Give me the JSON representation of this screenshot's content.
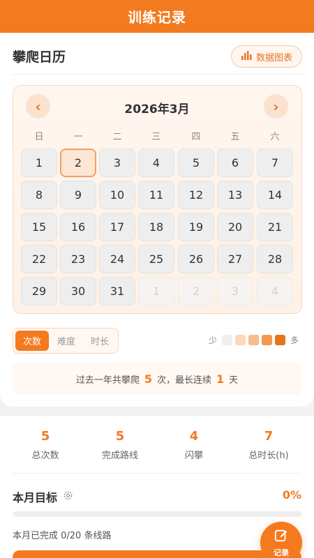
{
  "header": {
    "title": "训练记录"
  },
  "calendar_section": {
    "title": "攀爬日历",
    "chart_button": "数据图表",
    "month_label": "2026年3月",
    "prev": "‹",
    "next": "›",
    "weekdays": [
      "日",
      "一",
      "二",
      "三",
      "四",
      "五",
      "六"
    ],
    "days": [
      {
        "label": "1",
        "other": false
      },
      {
        "label": "2",
        "other": false,
        "today": true
      },
      {
        "label": "3",
        "other": false
      },
      {
        "label": "4",
        "other": false
      },
      {
        "label": "5",
        "other": false
      },
      {
        "label": "6",
        "other": false
      },
      {
        "label": "7",
        "other": false
      },
      {
        "label": "8",
        "other": false
      },
      {
        "label": "9",
        "other": false
      },
      {
        "label": "10",
        "other": false
      },
      {
        "label": "11",
        "other": false
      },
      {
        "label": "12",
        "other": false
      },
      {
        "label": "13",
        "other": false
      },
      {
        "label": "14",
        "other": false
      },
      {
        "label": "15",
        "other": false
      },
      {
        "label": "16",
        "other": false
      },
      {
        "label": "17",
        "other": false
      },
      {
        "label": "18",
        "other": false
      },
      {
        "label": "19",
        "other": false
      },
      {
        "label": "20",
        "other": false
      },
      {
        "label": "21",
        "other": false
      },
      {
        "label": "22",
        "other": false
      },
      {
        "label": "23",
        "other": false
      },
      {
        "label": "24",
        "other": false
      },
      {
        "label": "25",
        "other": false
      },
      {
        "label": "26",
        "other": false
      },
      {
        "label": "27",
        "other": false
      },
      {
        "label": "28",
        "other": false
      },
      {
        "label": "29",
        "other": false
      },
      {
        "label": "30",
        "other": false
      },
      {
        "label": "31",
        "other": false
      },
      {
        "label": "1",
        "other": true
      },
      {
        "label": "2",
        "other": true
      },
      {
        "label": "3",
        "other": true
      },
      {
        "label": "4",
        "other": true
      }
    ],
    "tabs": [
      {
        "label": "次数",
        "active": true
      },
      {
        "label": "难度",
        "active": false
      },
      {
        "label": "时长",
        "active": false
      }
    ],
    "legend": {
      "low": "少",
      "high": "多",
      "colors": [
        "#eeeeee",
        "#fbd9bd",
        "#f8bb8c",
        "#f4994f",
        "#e8741c"
      ]
    },
    "summary": {
      "prefix": "过去一年共攀爬",
      "count": "5",
      "middle": "次，最长连续",
      "streak": "1",
      "suffix": "天"
    }
  },
  "stats": [
    {
      "value": "5",
      "label": "总次数"
    },
    {
      "value": "5",
      "label": "完成路线"
    },
    {
      "value": "4",
      "label": "闪攀"
    },
    {
      "value": "7",
      "label": "总时长(h)"
    }
  ],
  "goal": {
    "title": "本月目标",
    "percent_label": "0%",
    "progress": 0,
    "progress_text": "本月已完成 0/20 条线路"
  },
  "fab": {
    "label": "记录"
  },
  "colors": {
    "accent": "#f47a1f"
  }
}
